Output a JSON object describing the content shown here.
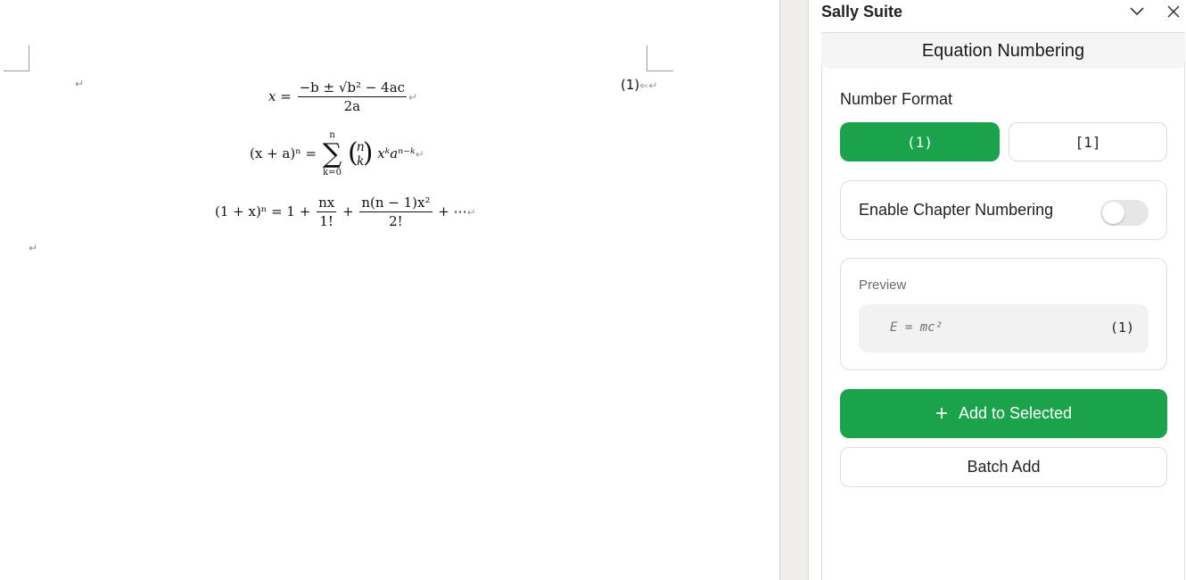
{
  "document": {
    "paragraph_mark": "↵",
    "equation_number": "(1)",
    "equations": {
      "quadratic": {
        "lhs": "x",
        "numerator": "−b ± √b² − 4ac",
        "denominator": "2a"
      },
      "binomial": {
        "lhs": "(x + a)ⁿ",
        "sum_upper": "n",
        "sum_lower": "k=0",
        "binom_top": "n",
        "binom_bottom": "k",
        "term": "xᵏaⁿ⁻ᵏ"
      },
      "expansion": {
        "lhs": "(1 + x)ⁿ = 1 +",
        "frac1_num": "nx",
        "frac1_den": "1!",
        "frac2_num": "n(n − 1)x²",
        "frac2_den": "2!",
        "tail": "+ ⋯"
      }
    }
  },
  "pane": {
    "title": "Sally Suite",
    "section_title": "Equation Numbering",
    "number_format_label": "Number Format",
    "formats": [
      {
        "label": "(1)",
        "selected": true
      },
      {
        "label": "[1]",
        "selected": false
      }
    ],
    "chapter_numbering": {
      "label": "Enable Chapter Numbering",
      "enabled": false
    },
    "preview": {
      "label": "Preview",
      "equation": "E = mc²",
      "number": "(1)"
    },
    "add_to_selected": {
      "icon": "plus-icon",
      "label": "Add to Selected"
    },
    "batch_add": {
      "label": "Batch Add"
    }
  },
  "colors": {
    "accent": "#1ba34b",
    "toggle_off": "#e6e6e6",
    "preview_bg": "#f2f2f2"
  }
}
